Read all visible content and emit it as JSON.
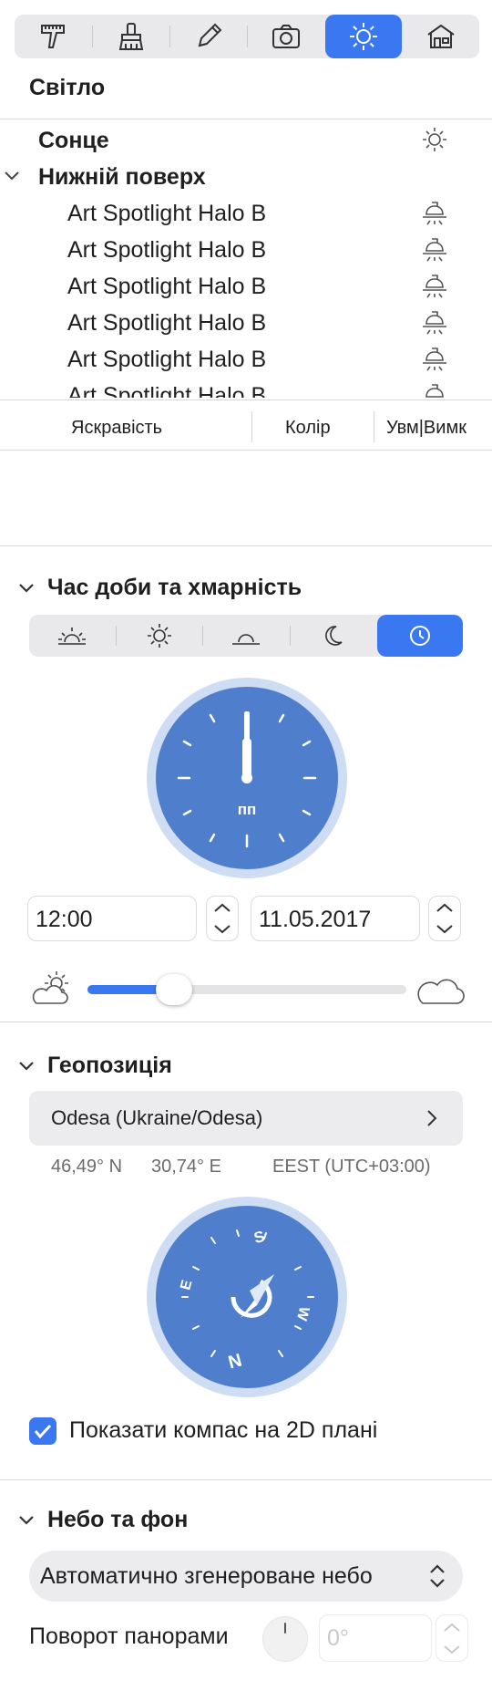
{
  "toolbar": {
    "items": [
      {
        "icon": "calipers-icon"
      },
      {
        "icon": "brush-icon"
      },
      {
        "icon": "pencil-icon"
      },
      {
        "icon": "camera-icon"
      },
      {
        "icon": "sun-icon",
        "active": true
      },
      {
        "icon": "house-icon"
      }
    ],
    "accent": "#3a78f2"
  },
  "panel_title": "Світло",
  "tree": {
    "sun_label": "Сонце",
    "group_label": "Нижній поверх",
    "items": [
      "Art Spotlight Halo B",
      "Art Spotlight Halo B",
      "Art Spotlight Halo B",
      "Art Spotlight Halo B",
      "Art Spotlight Halo B",
      "Art Spotlight Halo B"
    ]
  },
  "columns": {
    "brightness": "Яскравість",
    "color": "Колір",
    "onoff": "Увм|Вимк"
  },
  "time_section": {
    "title": "Час доби та хмарність",
    "modes": [
      "sunrise-icon",
      "sun-icon",
      "sunset-icon",
      "moon-icon",
      "clock-icon"
    ],
    "active_mode": "clock-icon",
    "clock_label": "пп",
    "time_value": "12:00",
    "date_value": "11.05.2017",
    "cloudiness_fraction": 0.27,
    "left_icon": "partly-cloudy-icon",
    "right_icon": "cloud-icon"
  },
  "geo_section": {
    "title": "Геопозиція",
    "location": "Odesa (Ukraine/Odesa)",
    "latitude": "46,49° N",
    "longitude": "30,74° E",
    "timezone": "EEST (UTC+03:00)",
    "compass_letters": {
      "n": "N",
      "s": "S",
      "e": "E",
      "w": "W"
    },
    "show_compass_label": "Показати компас на 2D плані",
    "show_compass_checked": true
  },
  "sky_section": {
    "title": "Небо та фон",
    "sky_type": "Автоматично згенероване небо",
    "pano_label": "Поворот панорами",
    "pano_placeholder": "0°"
  }
}
